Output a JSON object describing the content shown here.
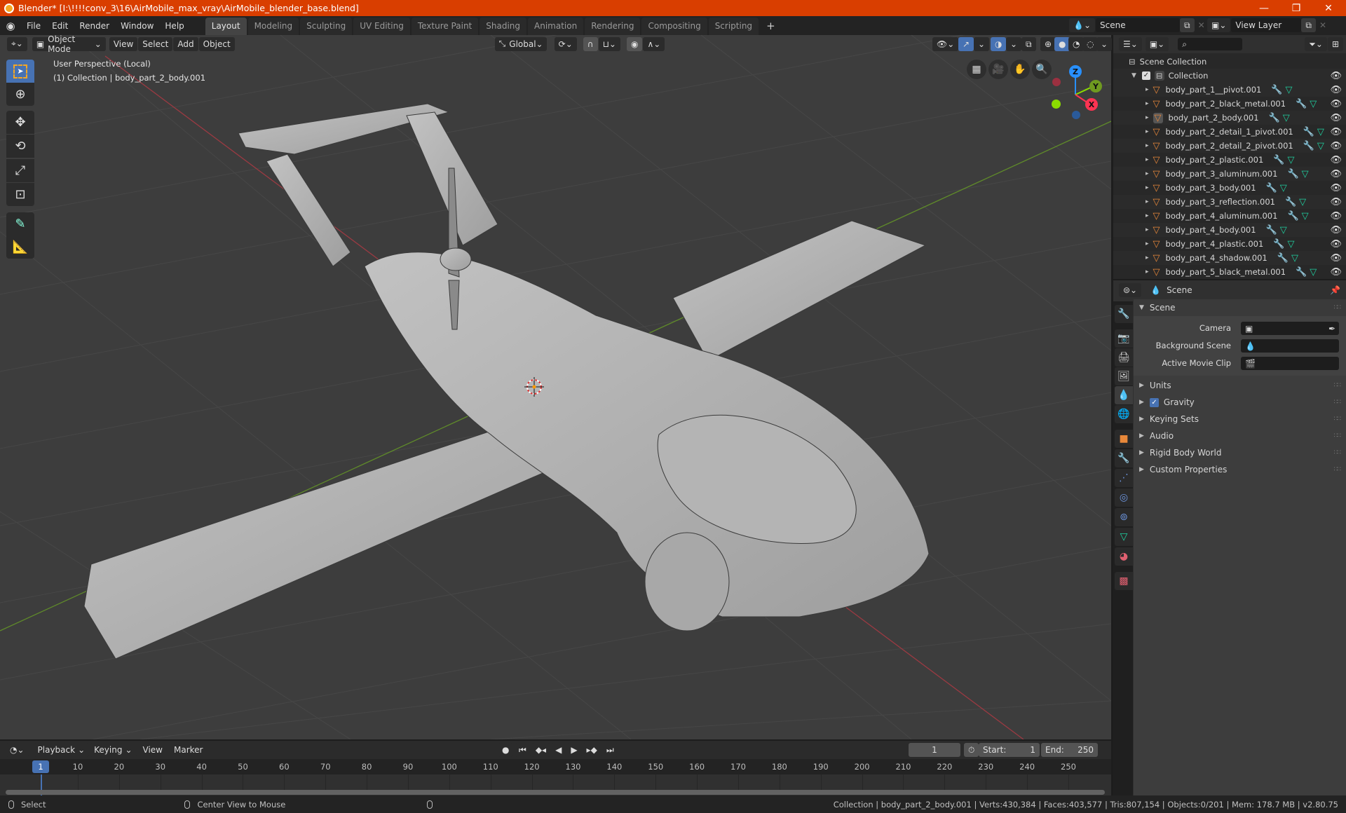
{
  "window": {
    "title": "Blender* [I:\\!!!!conv_3\\16\\AirMobile_max_vray\\AirMobile_blender_base.blend]",
    "controls": {
      "minimize": "—",
      "maximize": "❐",
      "close": "✕"
    }
  },
  "menu": [
    "File",
    "Edit",
    "Render",
    "Window",
    "Help"
  ],
  "workspaces": [
    {
      "label": "Layout",
      "active": true
    },
    {
      "label": "Modeling"
    },
    {
      "label": "Sculpting"
    },
    {
      "label": "UV Editing"
    },
    {
      "label": "Texture Paint"
    },
    {
      "label": "Shading"
    },
    {
      "label": "Animation"
    },
    {
      "label": "Rendering"
    },
    {
      "label": "Compositing"
    },
    {
      "label": "Scripting"
    }
  ],
  "add_workspace": "+",
  "scene_selector": {
    "value": "Scene"
  },
  "view_layer_selector": {
    "value": "View Layer"
  },
  "viewport_header": {
    "mode": "Object Mode",
    "menus": [
      "View",
      "Select",
      "Add",
      "Object"
    ],
    "transform_orientation": "Global"
  },
  "viewport": {
    "overlay_line1": "User Perspective (Local)",
    "overlay_line2": "(1) Collection | body_part_2_body.001",
    "gizmo_axes": {
      "z": "Z",
      "y": "Y",
      "x": "X"
    },
    "colors": {
      "x_axis": "#ff3352",
      "y_axis": "#8bdc00",
      "z_axis": "#2890ff",
      "grid_bg": "#3d3d3d",
      "model": "#b8b8b8"
    }
  },
  "tools": [
    "select-box",
    "cursor",
    "move",
    "rotate",
    "scale",
    "transform",
    "annotate",
    "measure"
  ],
  "outliner": {
    "root": "Scene Collection",
    "collection": "Collection",
    "items": [
      "body_part_1__pivot.001",
      "body_part_2_black_metal.001",
      "body_part_2_body.001",
      "body_part_2_detail_1_pivot.001",
      "body_part_2_detail_2_pivot.001",
      "body_part_2_plastic.001",
      "body_part_3_aluminum.001",
      "body_part_3_body.001",
      "body_part_3_reflection.001",
      "body_part_4_aluminum.001",
      "body_part_4_body.001",
      "body_part_4_plastic.001",
      "body_part_4_shadow.001",
      "body_part_5_black_metal.001"
    ],
    "active_item": "body_part_2_body.001"
  },
  "properties": {
    "context": "Scene",
    "panel_title": "Scene",
    "fields": [
      {
        "label": "Camera",
        "value": ""
      },
      {
        "label": "Background Scene",
        "value": ""
      },
      {
        "label": "Active Movie Clip",
        "value": ""
      }
    ],
    "sections": [
      {
        "label": "Units"
      },
      {
        "label": "Gravity",
        "checked": true
      },
      {
        "label": "Keying Sets"
      },
      {
        "label": "Audio"
      },
      {
        "label": "Rigid Body World"
      },
      {
        "label": "Custom Properties"
      }
    ]
  },
  "timeline": {
    "menus": [
      "Playback",
      "Keying",
      "View",
      "Marker"
    ],
    "current_frame": "1",
    "start_label": "Start:",
    "start": "1",
    "end_label": "End:",
    "end": "250",
    "ticks": [
      "10",
      "20",
      "30",
      "40",
      "50",
      "60",
      "70",
      "80",
      "90",
      "100",
      "110",
      "120",
      "130",
      "140",
      "150",
      "160",
      "170",
      "180",
      "190",
      "200",
      "210",
      "220",
      "230",
      "240",
      "250"
    ],
    "playhead": "1"
  },
  "statusbar": {
    "left_action": "Select",
    "middle_action": "Center View to Mouse",
    "stats": "Collection | body_part_2_body.001 | Verts:430,384 | Faces:403,577 | Tris:807,154 | Objects:0/201 | Mem: 178.7 MB | v2.80.75"
  }
}
